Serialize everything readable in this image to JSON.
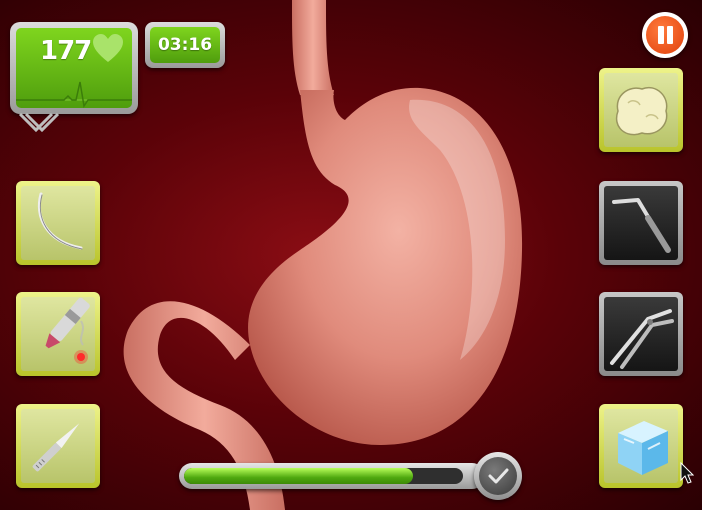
{
  "hud": {
    "heart_rate": "177",
    "timer": "03:16",
    "heart_icon": "heart-icon",
    "pause_icon": "pause-icon"
  },
  "tools_left": [
    {
      "name": "suture-thread",
      "icon": "suture-icon"
    },
    {
      "name": "laser-cauterizer",
      "icon": "laser-icon"
    },
    {
      "name": "scalpel",
      "icon": "scalpel-icon"
    }
  ],
  "tools_right": [
    {
      "name": "sponge",
      "icon": "sponge-icon",
      "highlighted": true
    },
    {
      "name": "probe",
      "icon": "probe-icon"
    },
    {
      "name": "forceps",
      "icon": "forceps-icon"
    },
    {
      "name": "ice-cube",
      "icon": "ice-cube-icon",
      "highlighted": true
    }
  ],
  "progress": {
    "fraction": 0.82,
    "confirm_icon": "check-icon"
  },
  "colors": {
    "background": "#5a0208",
    "monitor_green": "#6cc51a",
    "tool_highlight": "#d7e04a",
    "progress_green": "#5cbd15",
    "pause_orange": "#f05a1c"
  }
}
